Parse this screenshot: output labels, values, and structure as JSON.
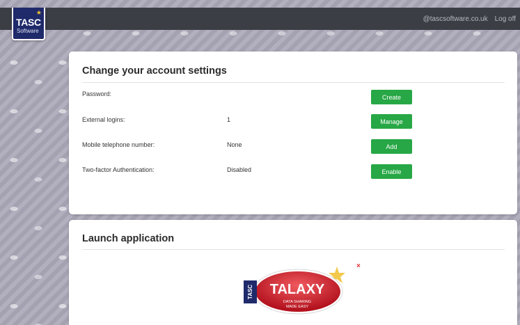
{
  "header": {
    "logo_text": "TASC",
    "logo_sub": "Software",
    "user_email": "@tascsoftware.co.uk",
    "logoff_label": "Log off"
  },
  "account_settings": {
    "title": "Change your account settings",
    "rows": [
      {
        "label": "Password:",
        "value": "",
        "button": "Create"
      },
      {
        "label": "External logins:",
        "value": "1",
        "button": "Manage"
      },
      {
        "label": "Mobile telephone number:",
        "value": "None",
        "button": "Add"
      },
      {
        "label": "Two-factor Authentication:",
        "value": "Disabled",
        "button": "Enable"
      }
    ]
  },
  "launch": {
    "title": "Launch application",
    "close_symbol": "×",
    "app_logo": {
      "badge": "TASC",
      "name": "TALAXY",
      "tagline_1": "DATA SHARING",
      "tagline_2": "MADE EASY"
    }
  },
  "colors": {
    "topbar": "#3b3f45",
    "button_green": "#27a745",
    "logo_navy": "#1f2a6b",
    "talaxy_red": "#cc1f2b"
  }
}
